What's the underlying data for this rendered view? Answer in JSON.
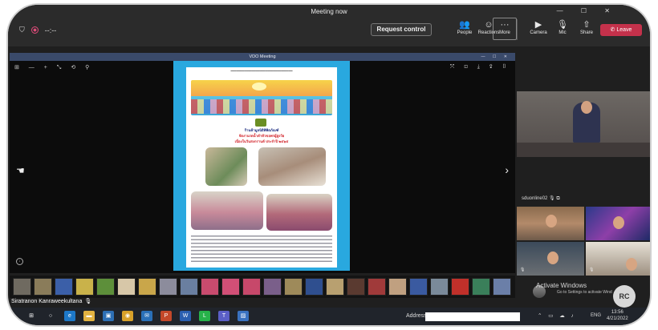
{
  "window": {
    "title": "Meeting now",
    "controls": "— ☐ ✕"
  },
  "topbar": {
    "timer": "--:--",
    "request_control": "Request control",
    "buttons": [
      {
        "label": "People",
        "icon": "people-icon",
        "glyph": "👥"
      },
      {
        "label": "Reactions",
        "icon": "reactions-icon",
        "glyph": "☺"
      },
      {
        "label": "More",
        "icon": "more-icon",
        "glyph": "···"
      },
      {
        "label": "Camera",
        "icon": "camera-icon",
        "glyph": "▶"
      },
      {
        "label": "Mic",
        "icon": "mic-icon",
        "glyph": "🎙"
      },
      {
        "label": "Share",
        "icon": "share-icon",
        "glyph": "⇧"
      }
    ],
    "leave": "Leave",
    "leave_color": "#c4314b"
  },
  "shared_window": {
    "title": "VDO Meeting",
    "tools_left": "⊞ — + ⤡ ⟲ ⚲",
    "tools_right": "⤧ ⊡ ⤓ ⇪ ▯",
    "poster": {
      "title_line1": "ร้านค้ามูลนิธิพิพิธภัณฑ์",
      "title_line2": "จัดงานรดน้ำดำหัวขอพรผู้สูงวัย",
      "title_line3": "เนื่องในวันสงกรานต์ ประจำปี ๒๕๖๕",
      "accent_color": "#29a8df"
    }
  },
  "filmstrip": {
    "thumb_colors": [
      "#6f6a60",
      "#8a7c5a",
      "#3b5fa8",
      "#c9b24a",
      "#5d8f3a",
      "#d7c7a8",
      "#c9a64a",
      "#8c8c9c",
      "#6a7fa0",
      "#c94b6e",
      "#d24f76",
      "#c7486a",
      "#7a5f8a",
      "#9e8a5a",
      "#2f4f8f",
      "#b8a070",
      "#5a3a30",
      "#a03a3a",
      "#c0a080",
      "#3a5aa0",
      "#7a8a9a",
      "#c0302a",
      "#3a7f5a",
      "#6b7fa8"
    ]
  },
  "participants": {
    "active_speaker_name": "Siratranon Kanraweekultana",
    "main_video_label": "sduonline02",
    "avatar_initials": "RC",
    "activate_line1": "Activate Windows",
    "activate_line2": "Go to Settings to activate Wind"
  },
  "taskbar": {
    "address_label": "Address",
    "language": "ENG",
    "time": "13:56",
    "date": "4/21/2022",
    "apps": [
      {
        "icon": "windows-start-icon",
        "glyph": "⊞",
        "color": "#20242b"
      },
      {
        "icon": "search-icon",
        "glyph": "○",
        "color": "#20242b"
      },
      {
        "icon": "edge-icon",
        "glyph": "e",
        "color": "#1d78c8"
      },
      {
        "icon": "file-explorer-icon",
        "glyph": "▬",
        "color": "#e3b341"
      },
      {
        "icon": "store-icon",
        "glyph": "▣",
        "color": "#2d6fb5"
      },
      {
        "icon": "chrome-icon",
        "glyph": "◉",
        "color": "#d8a12a"
      },
      {
        "icon": "mail-icon",
        "glyph": "✉",
        "color": "#2a70b8"
      },
      {
        "icon": "powerpoint-icon",
        "glyph": "P",
        "color": "#c4482a"
      },
      {
        "icon": "word-icon",
        "glyph": "W",
        "color": "#2b5fb0"
      },
      {
        "icon": "line-icon",
        "glyph": "L",
        "color": "#27b24a"
      },
      {
        "icon": "teams-icon",
        "glyph": "T",
        "color": "#5b5fc7"
      },
      {
        "icon": "photos-icon",
        "glyph": "▨",
        "color": "#3a72c0"
      }
    ]
  }
}
